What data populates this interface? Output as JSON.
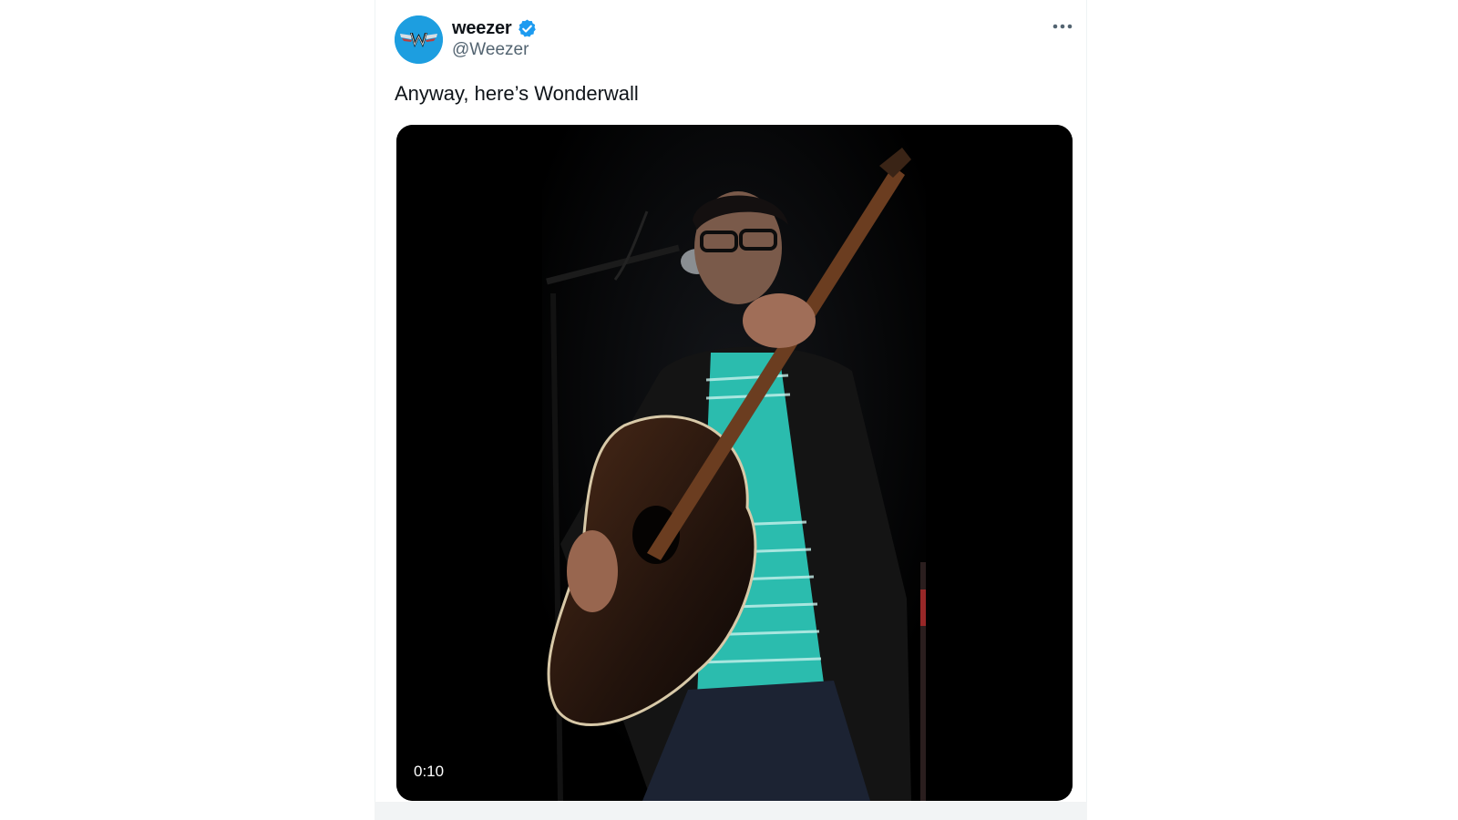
{
  "tweet": {
    "author": {
      "display_name": "weezer",
      "handle": "@Weezer",
      "verified": true,
      "avatar_icon": "weezer-w-logo",
      "avatar_color": "#1d9ee0"
    },
    "text": "Anyway, here’s Wonderwall",
    "more_icon": "more-horizontal-icon",
    "media": {
      "type": "video",
      "duration": "0:10",
      "description_icon": "video-frame"
    }
  },
  "colors": {
    "text_primary": "#0f1419",
    "text_secondary": "#536471",
    "verified_blue": "#1d9bf0",
    "background": "#ffffff"
  }
}
